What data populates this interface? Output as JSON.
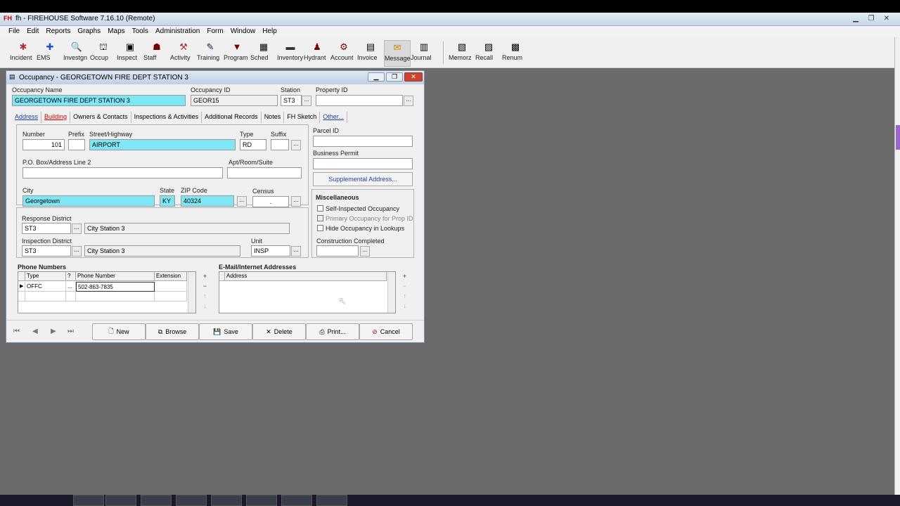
{
  "window": {
    "title": "FIREHOUSE Software 7.16.10 (Remote)",
    "app_abbrev": "FH",
    "app_prefix": "fh -"
  },
  "menu": [
    "File",
    "Edit",
    "Reports",
    "Graphs",
    "Maps",
    "Tools",
    "Administration",
    "Form",
    "Window",
    "Help"
  ],
  "toolbar": [
    {
      "label": "Incident",
      "icon": "incident-icon",
      "glyph": "✱"
    },
    {
      "label": "EMS",
      "icon": "ems-icon",
      "glyph": "✚"
    },
    {
      "label": "Investgn",
      "icon": "investigation-icon",
      "glyph": "🔍"
    },
    {
      "label": "Occup",
      "icon": "occupancy-icon",
      "glyph": "⛫"
    },
    {
      "label": "Inspect",
      "icon": "inspect-icon",
      "glyph": "▣"
    },
    {
      "label": "Staff",
      "icon": "staff-icon",
      "glyph": "☗"
    },
    {
      "label": "Activity",
      "icon": "activity-icon",
      "glyph": "⚒"
    },
    {
      "label": "Training",
      "icon": "training-icon",
      "glyph": "✎"
    },
    {
      "label": "Program",
      "icon": "program-icon",
      "glyph": "▼"
    },
    {
      "label": "Sched",
      "icon": "schedule-icon",
      "glyph": "▦"
    },
    {
      "label": "Inventory",
      "icon": "inventory-icon",
      "glyph": "▬"
    },
    {
      "label": "Hydrant",
      "icon": "hydrant-icon",
      "glyph": "♟"
    },
    {
      "label": "Account",
      "icon": "account-icon",
      "glyph": "⚙"
    },
    {
      "label": "Invoice",
      "icon": "invoice-icon",
      "glyph": "▤"
    },
    {
      "label": "Message",
      "icon": "message-icon",
      "glyph": "✉"
    },
    {
      "label": "Journal",
      "icon": "journal-icon",
      "glyph": "▥"
    },
    {
      "label": "Memorz",
      "icon": "memorize-icon",
      "glyph": "▧"
    },
    {
      "label": "Recall",
      "icon": "recall-icon",
      "glyph": "▨"
    },
    {
      "label": "Renum",
      "icon": "renumber-icon",
      "glyph": "▩"
    }
  ],
  "dialog": {
    "title": "Occupancy  - GEORGETOWN FIRE DEPT STATION 3",
    "occupancy_name_label": "Occupancy Name",
    "occupancy_name": "GEORGETOWN FIRE DEPT STATION 3",
    "occupancy_id_label": "Occupancy ID",
    "occupancy_id": "GEOR15",
    "station_label": "Station",
    "station": "ST3",
    "property_id_label": "Property ID",
    "property_id": "",
    "tabs": [
      "Address",
      "Building",
      "Owners & Contacts",
      "Inspections & Activities",
      "Additional Records",
      "Notes",
      "FH Sketch",
      "Other..."
    ],
    "address": {
      "number_label": "Number",
      "number": "101",
      "prefix_label": "Prefix",
      "prefix": "",
      "street_label": "Street/Highway",
      "street": "AIRPORT",
      "type_label": "Type",
      "type": "RD",
      "suffix_label": "Suffix",
      "suffix": "",
      "po_label": "P.O. Box/Address Line 2",
      "po": "",
      "apt_label": "Apt/Room/Suite",
      "apt": "",
      "city_label": "City",
      "city": "Georgetown",
      "state_label": "State",
      "state": "KY",
      "zip_label": "ZIP Code",
      "zip": "40324",
      "census_label": "Census",
      "census": ".",
      "parcel_label": "Parcel ID",
      "parcel": "",
      "permit_label": "Business Permit",
      "permit": "",
      "supplemental_label": "Supplemental Address..."
    },
    "response_district_label": "Response District",
    "response_district": "ST3",
    "response_district_desc": "City Station 3",
    "inspection_district_label": "Inspection District",
    "inspection_district": "ST3",
    "inspection_district_desc": "City Station 3",
    "unit_label": "Unit",
    "unit": "INSP",
    "misc": {
      "title": "Miscellaneous",
      "self_inspected": "Self-Inspected Occupancy",
      "primary_occupancy": "Primary Occupancy for Prop ID",
      "hide_occupancy": "Hide Occupancy in Lookups",
      "construction_label": "Construction Completed",
      "construction": ""
    },
    "phones": {
      "title": "Phone Numbers",
      "headers": [
        "Type",
        "?",
        "Phone Number",
        "Extension"
      ],
      "rows": [
        {
          "type": "OFFC",
          "phone": "502-863-7835",
          "ext": ""
        }
      ]
    },
    "emails": {
      "title": "E-Mail/Internet Addresses",
      "headers": [
        "Address"
      ]
    },
    "buttons": {
      "new": "New",
      "browse": "Browse",
      "save": "Save",
      "delete": "Delete",
      "print": "Print...",
      "cancel": "Cancel"
    }
  },
  "colors": {
    "required_field": "#7fe6f5",
    "workspace": "#6b6b6b",
    "link": "#1a3fa8",
    "warn_tab": "#cc0000"
  }
}
